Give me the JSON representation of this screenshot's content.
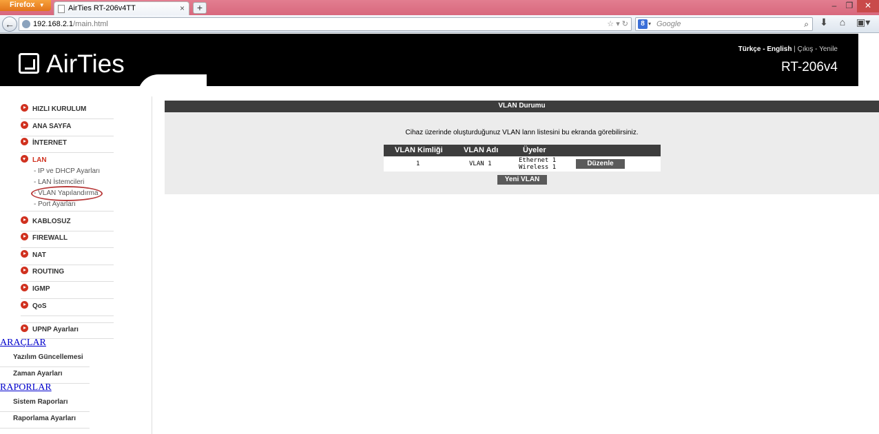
{
  "browser": {
    "app_button": "Firefox",
    "tab_title": "AirTies RT-206v4TT",
    "new_tab": "+",
    "url_host": "192.168.2.1",
    "url_path": "/main.html",
    "search_placeholder": "Google"
  },
  "header": {
    "logo_text": "AirTies",
    "lang_turkish": "Türkçe",
    "lang_english": "English",
    "separator": "|",
    "logout": "Çıkış",
    "refresh": "Yenile",
    "model": "RT-206v4"
  },
  "sidebar": {
    "items": [
      {
        "label": "HIZLI KURULUM"
      },
      {
        "label": "ANA SAYFA"
      },
      {
        "label": "İNTERNET"
      },
      {
        "label": "LAN"
      },
      {
        "label": "KABLOSUZ"
      },
      {
        "label": "FIREWALL"
      },
      {
        "label": "NAT"
      },
      {
        "label": "ROUTING"
      },
      {
        "label": "IGMP"
      },
      {
        "label": "QoS"
      },
      {
        "label": "UPNP Ayarları"
      }
    ],
    "lan_sub": [
      {
        "label": "- IP ve DHCP Ayarları"
      },
      {
        "label": "- LAN İstemcileri"
      },
      {
        "label": "- VLAN Yapılandırma"
      },
      {
        "label": "- Port Ayarları"
      }
    ],
    "tools_title": "ARAÇLAR",
    "tools": [
      {
        "label": "Yazılım Güncellemesi"
      },
      {
        "label": "Zaman Ayarları"
      }
    ],
    "reports_title": "RAPORLAR",
    "reports": [
      {
        "label": "Sistem Raporları"
      },
      {
        "label": "Raporlama Ayarları"
      }
    ]
  },
  "main": {
    "title": "VLAN Durumu",
    "info": "Cihaz üzerinde oluşturduğunuz VLAN lann listesini bu ekranda görebilirsiniz.",
    "table": {
      "headers": [
        "VLAN Kimliği",
        "VLAN Adı",
        "Üyeler"
      ],
      "rows": [
        {
          "id": "1",
          "name": "VLAN 1",
          "members": [
            "Ethernet 1",
            "Wireless 1"
          ],
          "action": "Düzenle"
        }
      ]
    },
    "new_button": "Yeni VLAN"
  }
}
